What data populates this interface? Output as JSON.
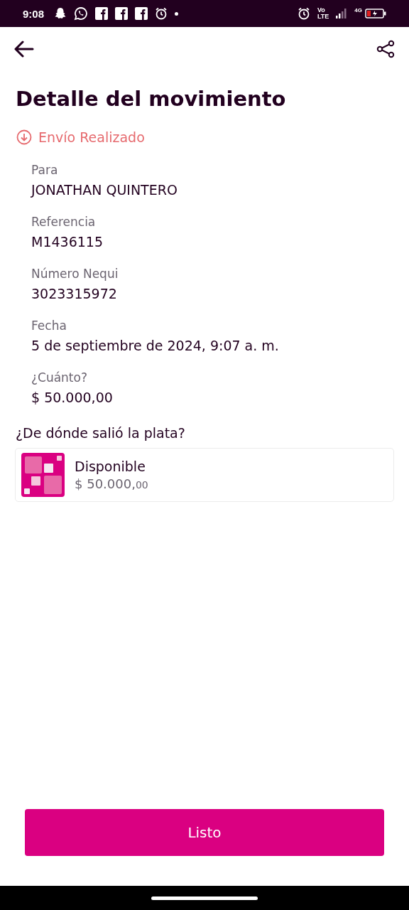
{
  "status_bar": {
    "time": "9:08",
    "volte_top": "Vo",
    "volte_bottom": "LTE",
    "network": "4G"
  },
  "title": "Detalle del movimiento",
  "status": "Envío Realizado",
  "fields": [
    {
      "label": "Para",
      "value": "JONATHAN QUINTERO"
    },
    {
      "label": "Referencia",
      "value": "M1436115"
    },
    {
      "label": "Número Nequi",
      "value": "3023315972"
    },
    {
      "label": "Fecha",
      "value": "5 de septiembre de 2024, 9:07 a. m."
    },
    {
      "label": "¿Cuánto?",
      "value": "$ 50.000,00"
    }
  ],
  "source": {
    "heading": "¿De dónde salió la plata?",
    "name": "Disponible",
    "amount": "$ 50.000,",
    "cents": "00"
  },
  "button": "Listo"
}
